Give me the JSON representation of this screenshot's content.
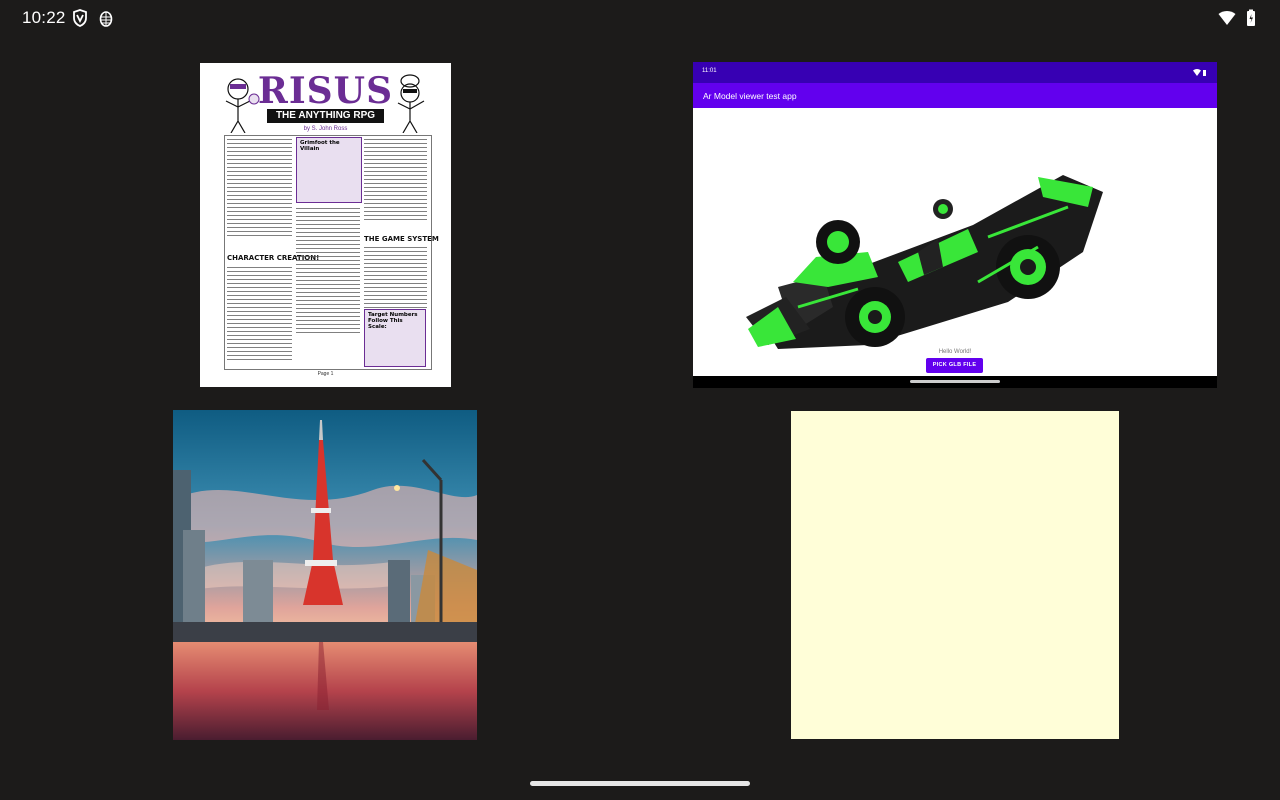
{
  "status_bar": {
    "time": "10:22",
    "left_icons": [
      "shield-v-icon",
      "pinecone-icon"
    ],
    "right_icons": [
      "wifi-icon",
      "battery-icon"
    ]
  },
  "document": {
    "title": "RISUS",
    "subtitle": "THE ANYTHING RPG",
    "author": "by S. John Ross",
    "heading_1": "CHARACTER CREATION!",
    "heading_2": "THE GAME SYSTEM",
    "sidebox_1": "Grimfoot the Villain",
    "sidebox_2": "Target Numbers Follow This Scale:",
    "page_label": "Page 1",
    "accent": "#6b2d94"
  },
  "ar_app": {
    "status_time": "11:01",
    "title": "Ar Model viewer test app",
    "hello_text": "Hello World!",
    "button_label": "PICK GLB FILE",
    "primary_color": "#6200ee",
    "dark_color": "#3700b3"
  },
  "photo": {
    "subject": "city-tower-photo"
  },
  "note": {
    "color": "#fffed8"
  }
}
